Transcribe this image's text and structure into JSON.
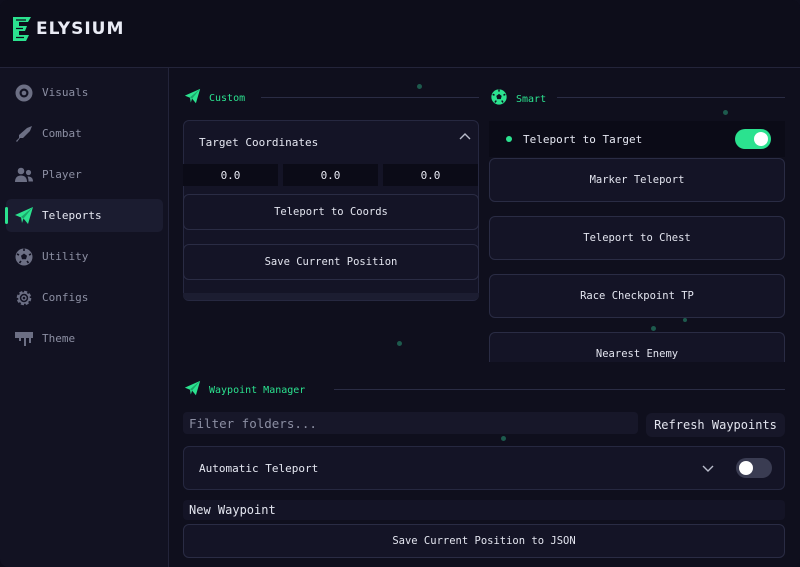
{
  "app": {
    "brand": "ELYSIUM"
  },
  "colors": {
    "accent": "#2be28f",
    "background": "#0f0f1d",
    "panel": "#141426"
  },
  "sidebar": {
    "items": [
      {
        "label": "Visuals",
        "icon": "eye-icon",
        "active": false
      },
      {
        "label": "Combat",
        "icon": "rifle-icon",
        "active": false
      },
      {
        "label": "Player",
        "icon": "users-icon",
        "active": false
      },
      {
        "label": "Teleports",
        "icon": "paper-plane-icon",
        "active": true
      },
      {
        "label": "Utility",
        "icon": "soccer-ball-icon",
        "active": false
      },
      {
        "label": "Configs",
        "icon": "gear-icon",
        "active": false
      },
      {
        "label": "Theme",
        "icon": "paint-drip-icon",
        "active": false
      }
    ]
  },
  "custom": {
    "title": "Custom",
    "target_label": "Target Coordinates",
    "coords": [
      "0.0",
      "0.0",
      "0.0"
    ],
    "teleport_button": "Teleport to Coords",
    "save_button": "Save Current Position"
  },
  "smart": {
    "title": "Smart",
    "toggle_label": "Teleport to Target",
    "toggle_on": true,
    "buttons": [
      "Marker Teleport",
      "Teleport to Chest",
      "Race Checkpoint TP",
      "Nearest Enemy"
    ]
  },
  "waypoints": {
    "title": "Waypoint Manager",
    "filter_placeholder": "Filter folders...",
    "refresh_button": "Refresh Waypoints",
    "auto_teleport_label": "Automatic Teleport",
    "auto_teleport_on": false,
    "name_value": "New Waypoint",
    "save_json_button": "Save Current Position to JSON"
  }
}
